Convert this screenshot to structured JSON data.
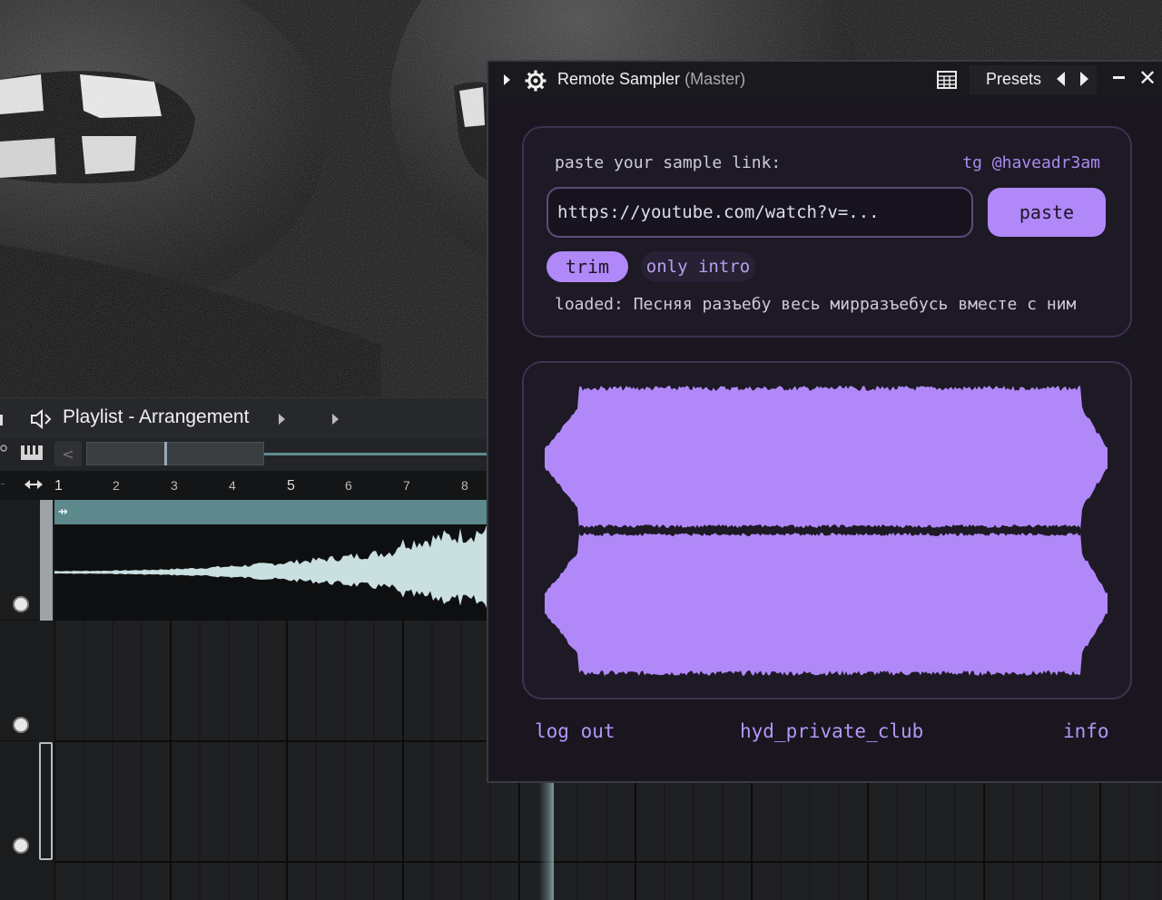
{
  "colors": {
    "accent": "#b088f7",
    "plugin_bg": "#191620",
    "panel_border": "#3b3350",
    "playlist_clip": "#5d898d",
    "playlist_wave": "#c9dfe0"
  },
  "playlist": {
    "title": "Playlist - Arrangement",
    "speaker_icon": "speaker-icon",
    "piano_icon": "piano-icon",
    "ruler_icon": "horizontal-arrows-icon",
    "scroll_back_label": "<",
    "bars": [
      "1",
      "2",
      "3",
      "4",
      "5",
      "6",
      "7",
      "8"
    ],
    "clip_icon": "⇸"
  },
  "plugin": {
    "title": "Remote Sampler",
    "title_sub": "(Master)",
    "presets_label": "Presets",
    "close_glyph": "✕",
    "paste_label": "paste your sample link:",
    "tg_label": "tg @haveadr3am",
    "url_value": "https://youtube.com/watch?v=...",
    "paste_button": "paste",
    "trim_chip": "trim",
    "intro_chip": "only intro",
    "loaded_text": "loaded: Песняя разъебу весь мирразъебусь вместе с ним",
    "footer": {
      "logout": "log out",
      "club": "hyd_private_club",
      "info": "info"
    }
  }
}
